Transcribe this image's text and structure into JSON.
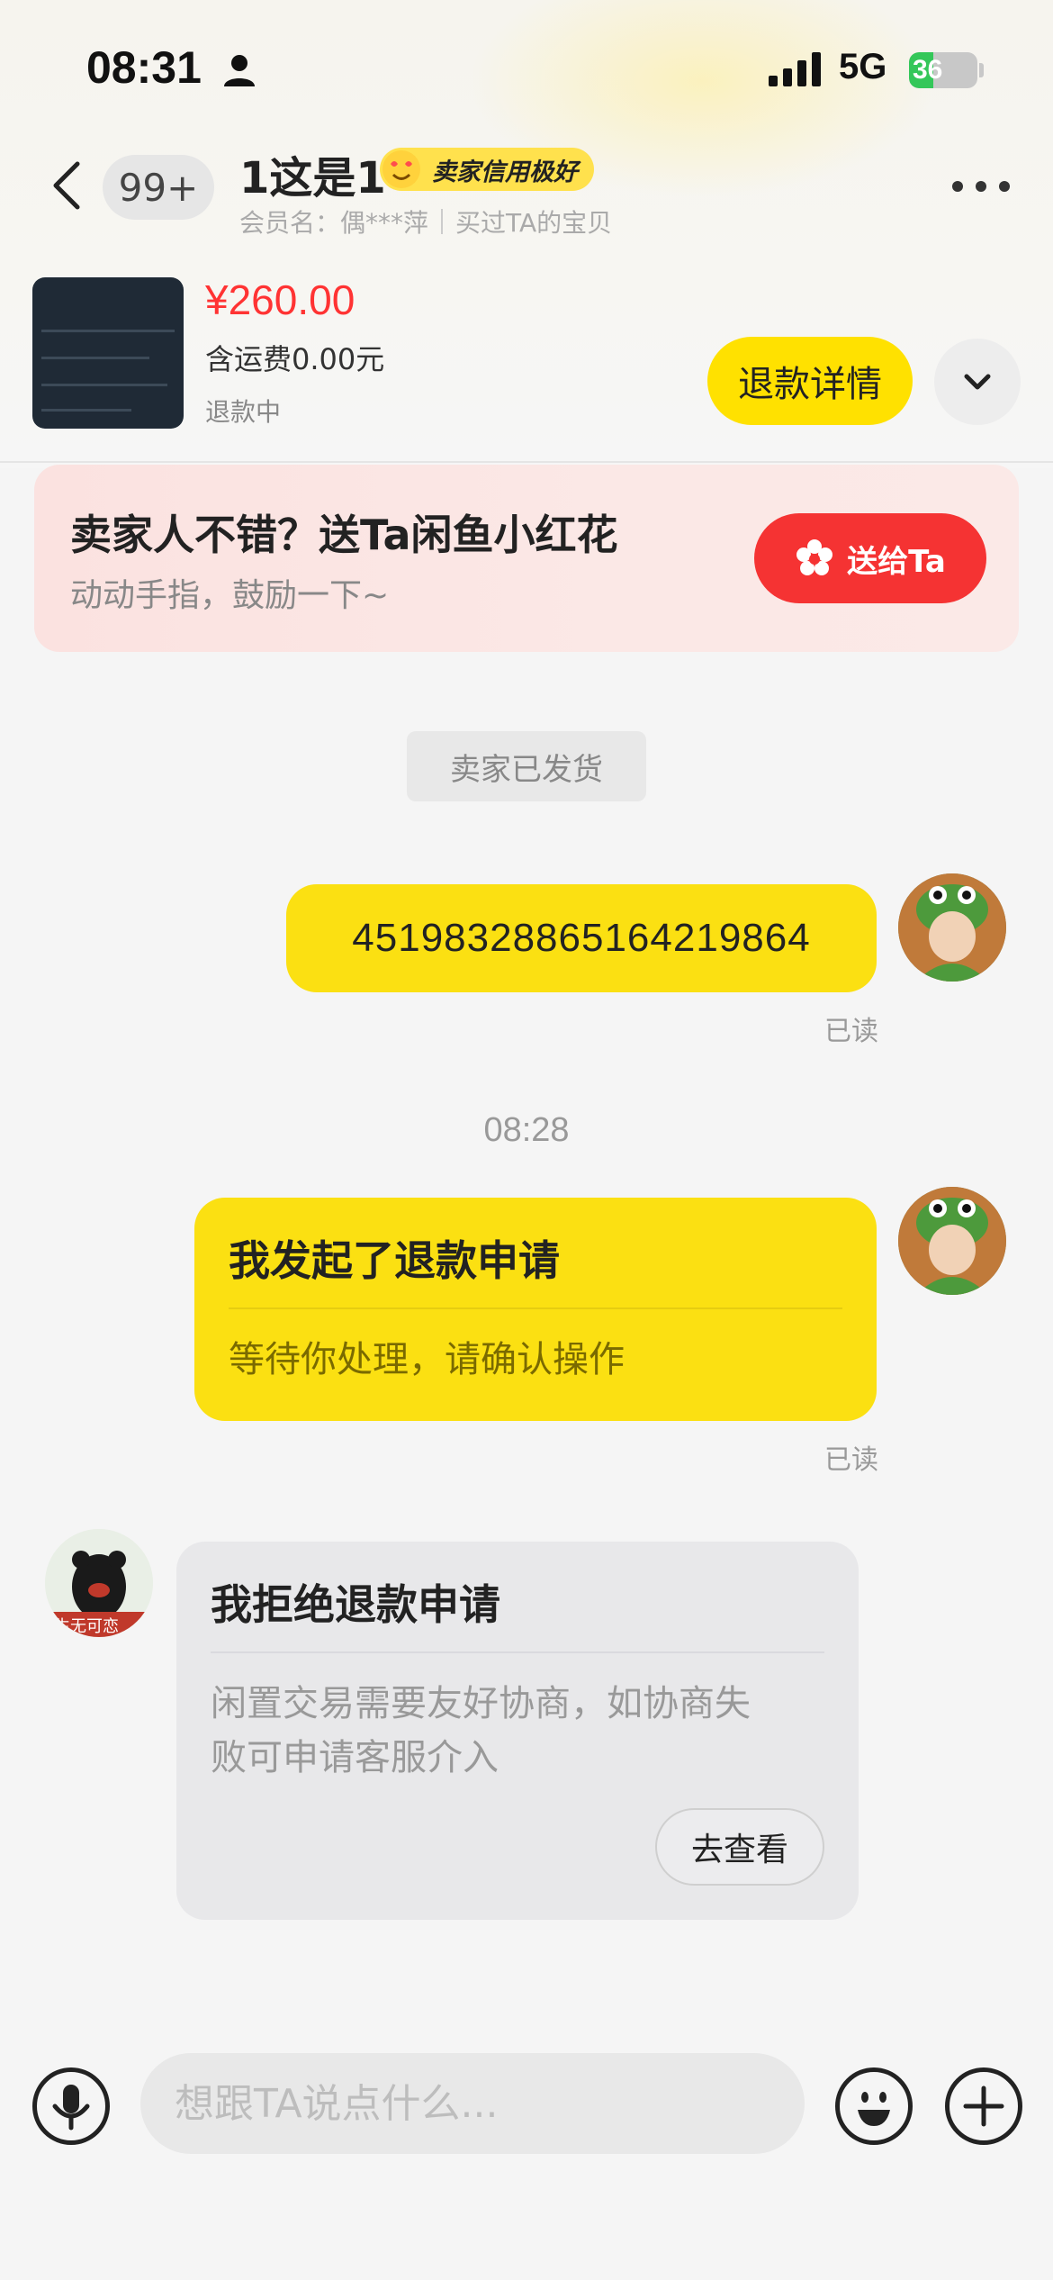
{
  "status_bar": {
    "time": "08:31",
    "network": "5G",
    "battery": "36",
    "battery_level_percent": 36
  },
  "header": {
    "unread_count": "99+",
    "chat_name": "1这是1",
    "credit_badge": "卖家信用极好",
    "member_name": "会员名：偶***萍",
    "purchase_note": "买过TA的宝贝"
  },
  "product": {
    "price": "¥260.00",
    "shipping": "含运费0.00元",
    "status": "退款中",
    "refund_button": "退款详情"
  },
  "banner": {
    "title": "卖家人不错？送Ta闲鱼小红花",
    "subtitle": "动动手指，鼓励一下~",
    "button": "送给Ta"
  },
  "messages": {
    "system_tip": "卖家已发货",
    "tracking_number": "4519832886516421986​4",
    "read_1": "已读",
    "time_divider": "08:28",
    "refund_card": {
      "title": "我发起了退款申请",
      "body": "等待你处理，请确认操作"
    },
    "read_2": "已读",
    "reject_card": {
      "title": "我拒绝退款申请",
      "body_line1": "闲置交易需要友好协商，如协商失",
      "body_line2": "败可申请客服介入",
      "button": "去查看"
    },
    "seller_avatar_caption": "生无可恋"
  },
  "input_bar": {
    "placeholder": "想跟TA说点什么..."
  },
  "colors": {
    "accent_yellow": "#ffe100",
    "price_red": "#ff3333",
    "send_red": "#f53333",
    "badge_yellow": "#ffe14d"
  },
  "icons": {
    "back": "chevron-left-icon",
    "more": "ellipsis-icon",
    "expand": "chevron-down-icon",
    "flower": "flower-icon",
    "voice": "microphone-icon",
    "emoji": "smiley-icon",
    "plus": "plus-icon"
  }
}
